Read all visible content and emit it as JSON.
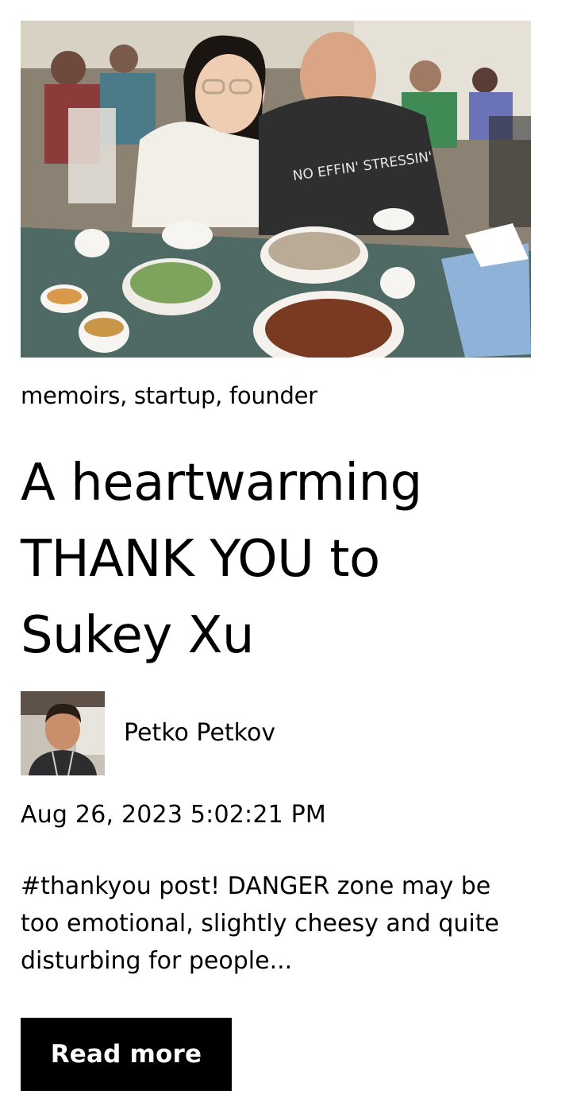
{
  "post": {
    "image_alt": "Two people smiling at a restaurant table with bowls of pho",
    "image_shirt_text": "NO EFFIN' STRESSIN'",
    "tags": "memoirs, startup, founder",
    "title": "A heartwarming THANK YOU to Sukey Xu",
    "author": {
      "name": "Petko Petkov"
    },
    "date": "Aug 26, 2023 5:02:21 PM",
    "excerpt": "#thankyou post! DANGER zone may be too emotional, slightly cheesy and quite disturbing for people...",
    "read_more_label": "Read more"
  },
  "colors": {
    "text": "#000000",
    "background": "#ffffff",
    "button_bg": "#000000",
    "button_text": "#ffffff"
  }
}
